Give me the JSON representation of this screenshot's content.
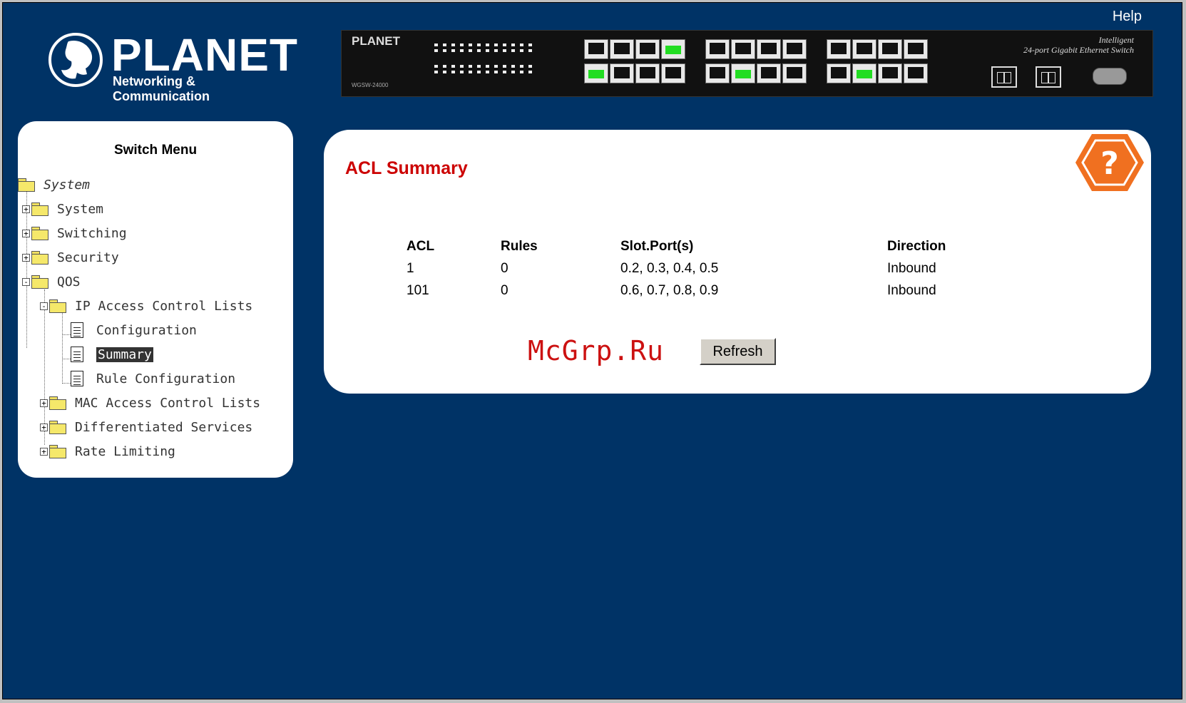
{
  "header": {
    "help_link": "Help",
    "logo": {
      "brand": "PLANET",
      "tagline": "Networking & Communication"
    },
    "switch_panel": {
      "brand": "PLANET",
      "model": "WGSW-24000",
      "description_line1": "Intelligent",
      "description_line2": "24-port Gigabit Ethernet Switch",
      "active_ports": [
        4,
        5,
        14,
        22
      ]
    }
  },
  "sidebar": {
    "title": "Switch Menu",
    "root_label": "System",
    "items": [
      {
        "label": "System",
        "expander": "+"
      },
      {
        "label": "Switching",
        "expander": "+"
      },
      {
        "label": "Security",
        "expander": "+"
      },
      {
        "label": "QOS",
        "expander": "-"
      },
      {
        "label": "IP Access Control Lists",
        "expander": "-"
      },
      {
        "label": "Configuration"
      },
      {
        "label": "Summary",
        "selected": true
      },
      {
        "label": "Rule Configuration"
      },
      {
        "label": "MAC Access Control Lists",
        "expander": "+"
      },
      {
        "label": "Differentiated Services",
        "expander": "+"
      },
      {
        "label": "Rate Limiting",
        "expander": "+"
      }
    ]
  },
  "main": {
    "title": "ACL Summary",
    "table": {
      "headers": [
        "ACL",
        "Rules",
        "Slot.Port(s)",
        "Direction"
      ],
      "rows": [
        [
          "1",
          "0",
          "0.2, 0.3, 0.4, 0.5",
          "Inbound"
        ],
        [
          "101",
          "0",
          "0.6, 0.7, 0.8, 0.9",
          "Inbound"
        ]
      ]
    },
    "watermark": "McGrp.Ru",
    "refresh_label": "Refresh",
    "help_icon": "question-mark-icon"
  },
  "colors": {
    "background": "#003366",
    "title_red": "#cc0000",
    "panel_white": "#ffffff",
    "help_orange": "#f07020"
  }
}
